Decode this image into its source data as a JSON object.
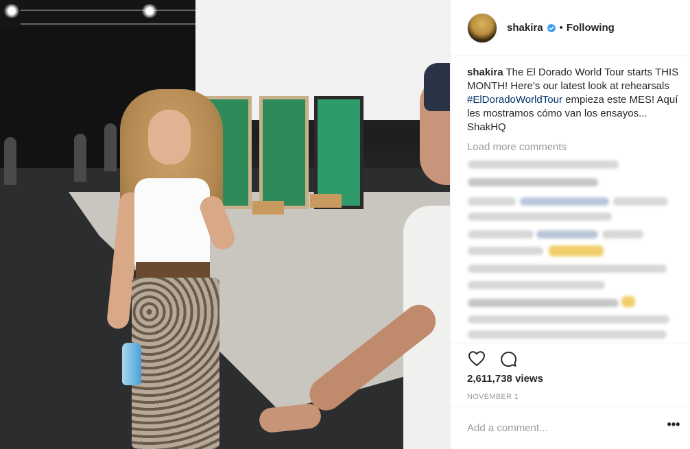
{
  "post": {
    "username": "shakira",
    "follow_state": "Following",
    "separator": "•",
    "caption": {
      "username": "shakira",
      "text_before_tag": " The El Dorado World Tour starts THIS MONTH! Here’s our latest look at rehearsals ",
      "hashtag": "#ElDoradoWorldTour",
      "text_after_tag": " empieza este MES! Aquí les mostramos cómo van los ensayos... ShakHQ"
    },
    "load_more_label": "Load more comments",
    "views": "2,611,738 views",
    "date": "NOVEMBER 1",
    "add_comment_placeholder": "Add a comment...",
    "more_options_glyph": "•••"
  },
  "icons": {
    "like": "heart-icon",
    "comment": "comment-icon",
    "verified": "verified-badge-icon",
    "more": "more-options-icon"
  },
  "colors": {
    "hashtag": "#003569",
    "verified": "#3897f0",
    "muted_text": "#999999",
    "primary_text": "#262626"
  }
}
